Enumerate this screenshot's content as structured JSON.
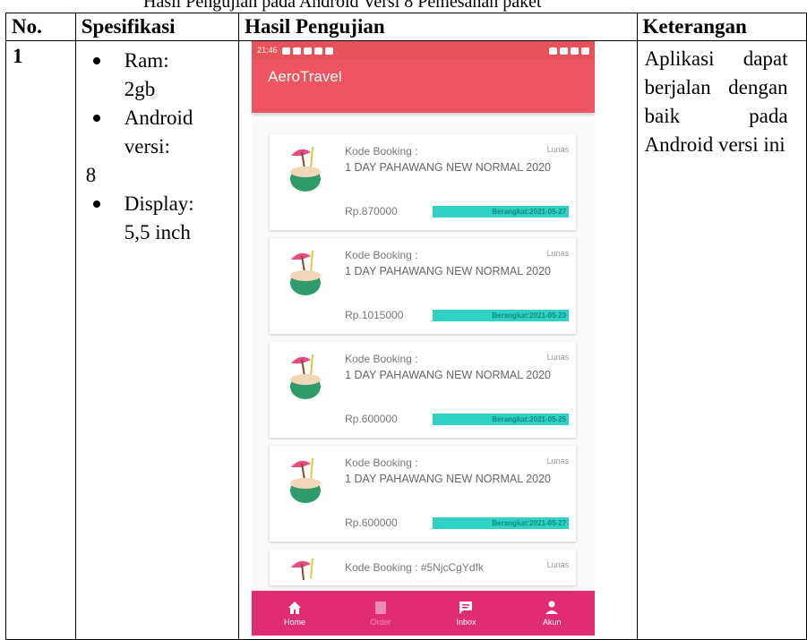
{
  "caption": "Hasil Pengujian pada Android Versi 8 Pemesanan paket",
  "table": {
    "headers": {
      "no": "No.",
      "spec": "Spesifikasi",
      "result": "Hasil Pengujian",
      "note": "Keterangan"
    },
    "row": {
      "no": "1",
      "specs": {
        "ram": "Ram:",
        "ram_val": "2gb",
        "android": "Android",
        "android_ver_label": "versi:",
        "android_ver": "8",
        "display": "Display:",
        "display_val": "5,5 inch"
      },
      "note": "Aplikasi dapat berjalan dengan baik pada Android versi ini"
    }
  },
  "phone": {
    "status_time": "21:46",
    "app_title": "AeroTravel",
    "bookings": [
      {
        "label": "Kode Booking :",
        "status": "Lunas",
        "package": "1 DAY PAHAWANG NEW NORMAL 2020",
        "price": "Rp.870000",
        "depart": "Berangkat:2021-05-27"
      },
      {
        "label": "Kode Booking :",
        "status": "Lunas",
        "package": "1 DAY PAHAWANG NEW NORMAL 2020",
        "price": "Rp.1015000",
        "depart": "Berangkat:2021-05-23"
      },
      {
        "label": "Kode Booking :",
        "status": "Lunas",
        "package": "1 DAY PAHAWANG NEW NORMAL 2020",
        "price": "Rp.600000",
        "depart": "Berangkat:2021-05-25"
      },
      {
        "label": "Kode Booking :",
        "status": "Lunas",
        "package": "1 DAY PAHAWANG NEW NORMAL 2020",
        "price": "Rp.600000",
        "depart": "Berangkat:2021-05-27"
      }
    ],
    "partial_booking": {
      "label": "Kode Booking : #5NjcCgYdfk",
      "status": "Lunas"
    },
    "nav": {
      "home": "Home",
      "order": "Order",
      "inbox": "Inbox",
      "account": "Akun"
    },
    "colors": {
      "appbar": "#ee5462",
      "nav": "#e02c73",
      "depart_badge": "#2ed1c4"
    }
  }
}
